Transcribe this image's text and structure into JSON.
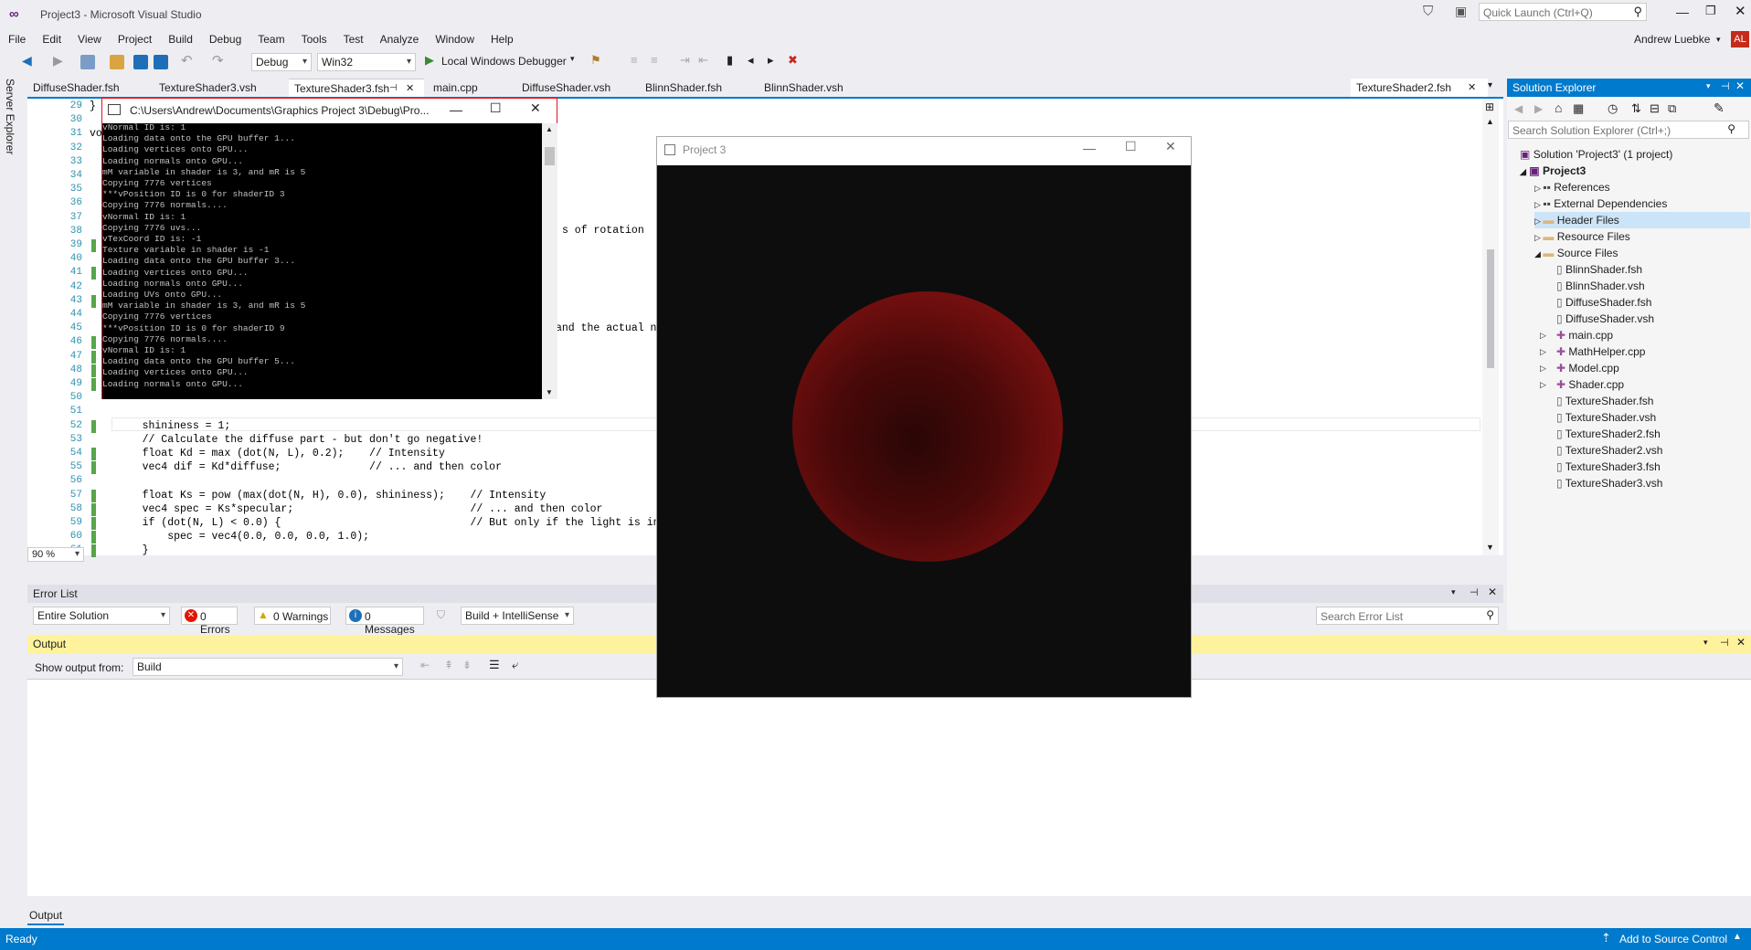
{
  "app": {
    "title": "Project3 - Microsoft Visual Studio",
    "quick_launch_placeholder": "Quick Launch (Ctrl+Q)",
    "user_name": "Andrew Luebke",
    "user_initials": "AL"
  },
  "menu": [
    "File",
    "Edit",
    "View",
    "Project",
    "Build",
    "Debug",
    "Team",
    "Tools",
    "Test",
    "Analyze",
    "Window",
    "Help"
  ],
  "toolbar": {
    "configuration": "Debug",
    "platform": "Win32",
    "debugger_label": "Local Windows Debugger"
  },
  "left_strip": {
    "label": "Server Explorer"
  },
  "tabs": [
    {
      "label": "DiffuseShader.fsh"
    },
    {
      "label": "TextureShader3.vsh"
    },
    {
      "label": "TextureShader3.fsh"
    },
    {
      "label": "main.cpp"
    },
    {
      "label": "DiffuseShader.vsh"
    },
    {
      "label": "BlinnShader.fsh"
    },
    {
      "label": "BlinnShader.vsh"
    },
    {
      "label": "TextureShader2.fsh"
    }
  ],
  "editor": {
    "zoom": "90 %",
    "lines": [
      {
        "n": "29",
        "t": "}"
      },
      {
        "n": "30",
        "t": ""
      },
      {
        "n": "31",
        "t": "vo"
      },
      {
        "n": "32",
        "t": ""
      },
      {
        "n": "33",
        "t": ""
      },
      {
        "n": "34",
        "t": ""
      },
      {
        "n": "35",
        "t": ""
      },
      {
        "n": "36",
        "t": ""
      },
      {
        "n": "37",
        "t": ""
      },
      {
        "n": "38",
        "t": ""
      },
      {
        "n": "39",
        "t": ""
      },
      {
        "n": "40",
        "t": ""
      },
      {
        "n": "41",
        "t": ""
      },
      {
        "n": "42",
        "t": ""
      },
      {
        "n": "43",
        "t": ""
      },
      {
        "n": "44",
        "t": ""
      },
      {
        "n": "45",
        "t": ""
      },
      {
        "n": "46",
        "t": ""
      },
      {
        "n": "47",
        "t": ""
      },
      {
        "n": "48",
        "t": ""
      },
      {
        "n": "49",
        "t": ""
      },
      {
        "n": "50",
        "t": ""
      },
      {
        "n": "51",
        "t": ""
      },
      {
        "n": "52",
        "t": "    shininess = 1;"
      },
      {
        "n": "53",
        "t": "    // Calculate the diffuse part - but don't go negative!"
      },
      {
        "n": "54",
        "t": "    float Kd = max (dot(N, L), 0.2);    // Intensity"
      },
      {
        "n": "55",
        "t": "    vec4 dif = Kd*diffuse;              // ... and then color"
      },
      {
        "n": "56",
        "t": ""
      },
      {
        "n": "57",
        "t": "    float Ks = pow (max(dot(N, H), 0.0), shininess);    // Intensity"
      },
      {
        "n": "58",
        "t": "    vec4 spec = Ks*specular;                            // ... and then color"
      },
      {
        "n": "59",
        "t": "    if (dot(N, L) < 0.0) {                              // But only if the light is in front!"
      },
      {
        "n": "60",
        "t": "        spec = vec4(0.0, 0.0, 0.0, 1.0);"
      },
      {
        "n": "61",
        "t": "    }"
      }
    ],
    "partial_text_1": "s of rotation",
    "partial_text_2": "and the actual nor"
  },
  "console": {
    "title": "C:\\Users\\Andrew\\Documents\\Graphics Project 3\\Debug\\Pro...",
    "lines": [
      "vNormal ID is: 1",
      "Loading data onto the GPU buffer 1...",
      "Loading vertices onto GPU...",
      "Loading normals onto GPU...",
      "mM variable in shader is 3, and mR is 5",
      "Copying 7776 vertices",
      "***vPosition ID is 0 for shaderID 3",
      "Copying 7776 normals....",
      "vNormal ID is: 1",
      "Copying 7776 uvs...",
      "vTexCoord ID is: -1",
      "Texture variable in shader is -1",
      "Loading data onto the GPU buffer 3...",
      "Loading vertices onto GPU...",
      "Loading normals onto GPU...",
      "Loading UVs onto GPU...",
      "mM variable in shader is 3, and mR is 5",
      "Copying 7776 vertices",
      "***vPosition ID is 0 for shaderID 9",
      "Copying 7776 normals....",
      "vNormal ID is: 1",
      "Loading data onto the GPU buffer 5...",
      "Loading vertices onto GPU...",
      "Loading normals onto GPU..."
    ]
  },
  "render_window": {
    "title": "Project 3"
  },
  "error_list": {
    "title": "Error List",
    "scope": "Entire Solution",
    "errors": "0 Errors",
    "warnings": "0 Warnings",
    "messages": "0 Messages",
    "filter": "Build + IntelliSense",
    "search_placeholder": "Search Error List"
  },
  "output": {
    "title": "Output",
    "show_from_label": "Show output from:",
    "source": "Build",
    "bottom_tab": "Output"
  },
  "solution_explorer": {
    "title": "Solution Explorer",
    "search_placeholder": "Search Solution Explorer (Ctrl+;)",
    "solution": "Solution 'Project3' (1 project)",
    "project": "Project3",
    "folders": [
      "References",
      "External Dependencies",
      "Header Files",
      "Resource Files",
      "Source Files"
    ],
    "files": [
      "BlinnShader.fsh",
      "BlinnShader.vsh",
      "DiffuseShader.fsh",
      "DiffuseShader.vsh",
      "main.cpp",
      "MathHelper.cpp",
      "Model.cpp",
      "Shader.cpp",
      "TextureShader.fsh",
      "TextureShader.vsh",
      "TextureShader2.fsh",
      "TextureShader2.vsh",
      "TextureShader3.fsh",
      "TextureShader3.vsh"
    ]
  },
  "status": {
    "left": "Ready",
    "right": "Add to Source Control"
  },
  "colors": {
    "accent": "#007acc",
    "sphere": "#8b1111",
    "console_bg": "#000000"
  }
}
